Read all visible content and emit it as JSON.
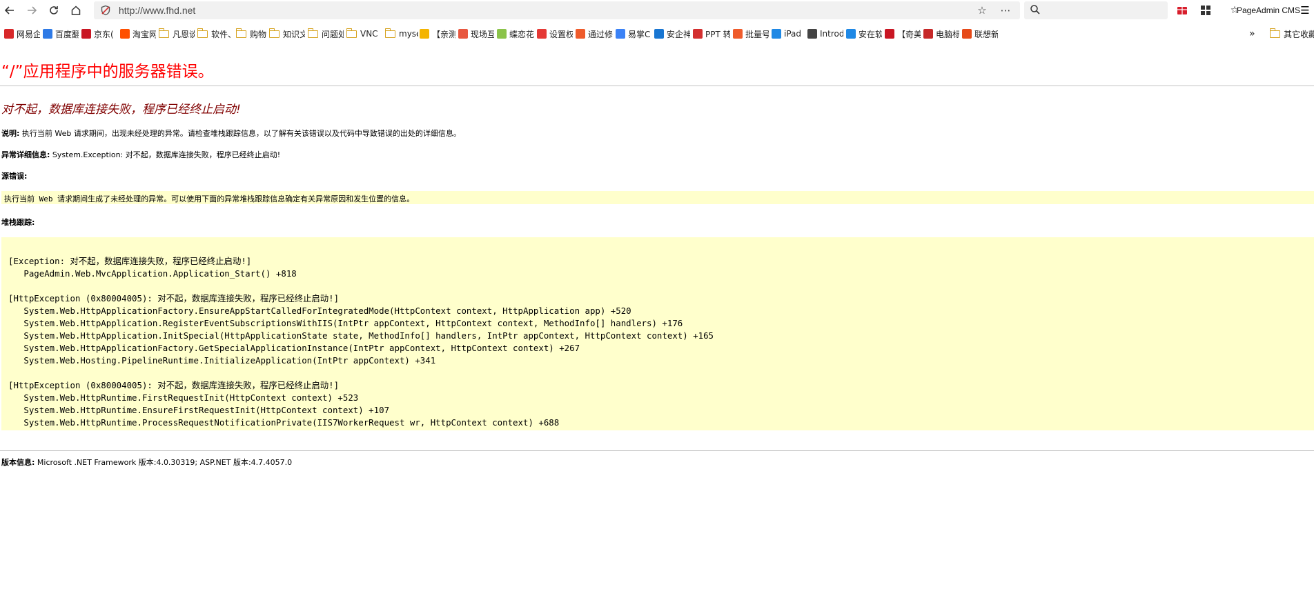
{
  "browser": {
    "url": "http://www.fhd.net",
    "search_placeholder": "",
    "extension_label": "PageAdmin CMS"
  },
  "bookmarks": [
    {
      "label": "网易企",
      "icon": "netease-icon",
      "color": "#d8282a"
    },
    {
      "label": "百度翻",
      "icon": "baidu-translate-icon",
      "color": "#2e7ae6"
    },
    {
      "label": "京东(",
      "icon": "jd-icon",
      "color": "#c91623"
    },
    {
      "label": "淘宝网",
      "icon": "taobao-icon",
      "color": "#ff5000"
    },
    {
      "label": "凡恩谈",
      "icon": "folder-icon",
      "color": "#d6a21e"
    },
    {
      "label": "软件、",
      "icon": "folder-icon",
      "color": "#d6a21e"
    },
    {
      "label": "购物",
      "icon": "folder-icon",
      "color": "#d6a21e"
    },
    {
      "label": "知识文",
      "icon": "folder-icon",
      "color": "#d6a21e"
    },
    {
      "label": "问题处",
      "icon": "folder-icon",
      "color": "#d6a21e"
    },
    {
      "label": "VNC",
      "icon": "folder-icon",
      "color": "#d6a21e"
    },
    {
      "label": "myself",
      "icon": "folder-icon",
      "color": "#d6a21e"
    },
    {
      "label": "【亲测",
      "icon": "site-icon",
      "color": "#f4b400"
    },
    {
      "label": "现场互",
      "icon": "site-icon",
      "color": "#e8573f"
    },
    {
      "label": "蝶恋花",
      "icon": "site-icon",
      "color": "#8bc34a"
    },
    {
      "label": "设置权",
      "icon": "site-icon",
      "color": "#e53935"
    },
    {
      "label": "通过修",
      "icon": "site-icon",
      "color": "#ef5b2b"
    },
    {
      "label": "易掌C",
      "icon": "site-icon",
      "color": "#3b82f6"
    },
    {
      "label": "安企神",
      "icon": "site-icon",
      "color": "#1976d2"
    },
    {
      "label": "PPT 转",
      "icon": "site-icon",
      "color": "#d32f2f"
    },
    {
      "label": "批量号",
      "icon": "site-icon",
      "color": "#ef5b2b"
    },
    {
      "label": "iPad",
      "icon": "site-icon",
      "color": "#1e88e5"
    },
    {
      "label": "Introd",
      "icon": "site-icon",
      "color": "#444444"
    },
    {
      "label": "安在软",
      "icon": "site-icon",
      "color": "#1e88e5"
    },
    {
      "label": "【奇美",
      "icon": "site-icon",
      "color": "#c91623"
    },
    {
      "label": "电脑标",
      "icon": "site-icon",
      "color": "#c62828"
    },
    {
      "label": "联想新",
      "icon": "site-icon",
      "color": "#e64a19"
    }
  ],
  "bookmarks_overflow": "»",
  "other_bookmarks": "其它收藏",
  "error": {
    "title": "“/”应用程序中的服务器错误。",
    "subtitle": "对不起，数据库连接失败，程序已经终止启动!",
    "description_label": "说明:",
    "description_text": " 执行当前 Web 请求期间，出现未经处理的异常。请检查堆栈跟踪信息，以了解有关该错误以及代码中导致错误的出处的详细信息。",
    "exception_label": "异常详细信息:",
    "exception_text": " System.Exception: 对不起，数据库连接失败，程序已经终止启动!",
    "source_label": "源错误:",
    "source_text": "执行当前 Web 请求期间生成了未经处理的异常。可以使用下面的异常堆栈跟踪信息确定有关异常原因和发生位置的信息。",
    "stack_label": "堆栈跟踪:",
    "stack_trace": "[Exception: 对不起，数据库连接失败，程序已经终止启动!]\n   PageAdmin.Web.MvcApplication.Application_Start() +818\n\n[HttpException (0x80004005): 对不起，数据库连接失败，程序已经终止启动!]\n   System.Web.HttpApplicationFactory.EnsureAppStartCalledForIntegratedMode(HttpContext context, HttpApplication app) +520\n   System.Web.HttpApplication.RegisterEventSubscriptionsWithIIS(IntPtr appContext, HttpContext context, MethodInfo[] handlers) +176\n   System.Web.HttpApplication.InitSpecial(HttpApplicationState state, MethodInfo[] handlers, IntPtr appContext, HttpContext context) +165\n   System.Web.HttpApplicationFactory.GetSpecialApplicationInstance(IntPtr appContext, HttpContext context) +267\n   System.Web.Hosting.PipelineRuntime.InitializeApplication(IntPtr appContext) +341\n\n[HttpException (0x80004005): 对不起，数据库连接失败，程序已经终止启动!]\n   System.Web.HttpRuntime.FirstRequestInit(HttpContext context) +523\n   System.Web.HttpRuntime.EnsureFirstRequestInit(HttpContext context) +107\n   System.Web.HttpRuntime.ProcessRequestNotificationPrivate(IIS7WorkerRequest wr, HttpContext context) +688",
    "version_label": "版本信息:",
    "version_text": " Microsoft .NET Framework 版本:4.0.30319; ASP.NET 版本:4.7.4057.0"
  }
}
